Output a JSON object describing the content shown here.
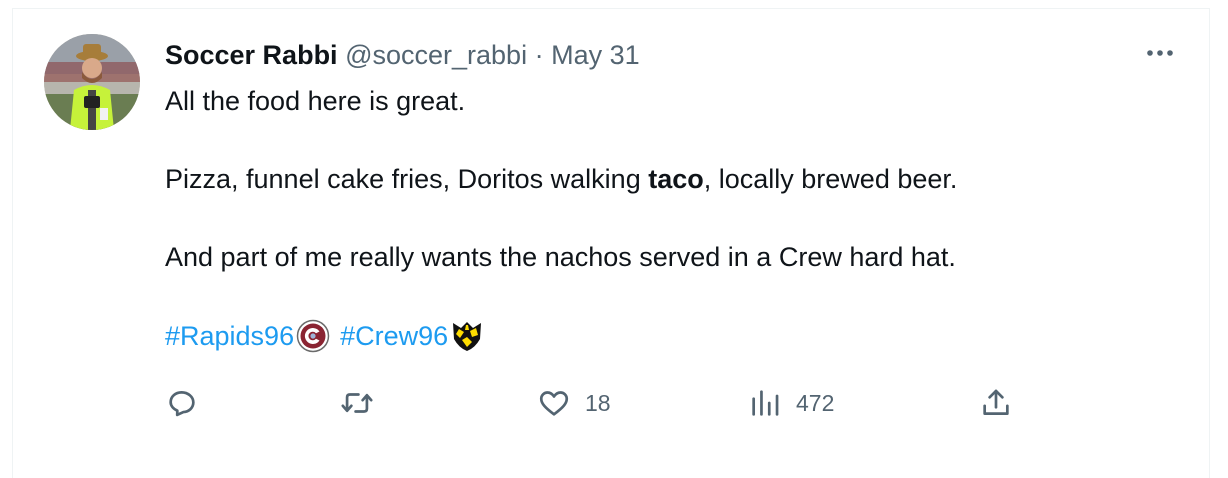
{
  "tweet": {
    "author_name": "Soccer Rabbi",
    "handle": "@soccer_rabbi",
    "separator": "·",
    "date": "May 31",
    "lines": {
      "first": "All the food here is great.",
      "second_before": "Pizza, funnel cake fries, Doritos walking ",
      "second_bold": "taco",
      "second_after": ", locally brewed beer.",
      "third": "And part of me really wants the nachos served in a Crew hard hat."
    },
    "hashtags": [
      "#Rapids96",
      "#Crew96"
    ]
  },
  "actions": {
    "reply_count": "",
    "retweet_count": "",
    "like_count": "18",
    "views_count": "472"
  },
  "icons": {
    "more": "more-horizontal-icon",
    "reply": "reply-icon",
    "retweet": "retweet-icon",
    "like": "heart-icon",
    "views": "views-icon",
    "share": "share-icon"
  },
  "colors": {
    "link": "#1d9bf0",
    "muted": "#536471",
    "text": "#0f1419",
    "rapids_maroon": "#8a2432",
    "crew_yellow": "#fedd00"
  }
}
